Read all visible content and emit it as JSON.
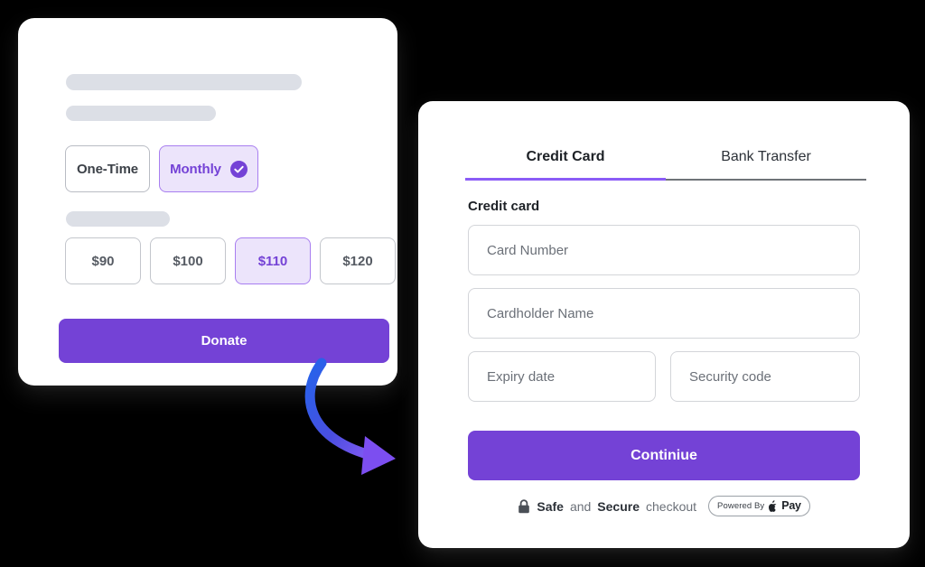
{
  "theme": {
    "background": "#000000",
    "card_bg": "#ffffff",
    "accent_purple": "#7442d6",
    "accent_purple_light": "#ece4fb",
    "accent_border": "#a87ef0",
    "tab_underline": "#8b5cf6",
    "skeleton_gray": "#dcdfe6",
    "text_dark": "#1d2126",
    "text_muted": "#6b7078",
    "arrow_gradient_from": "#2563eb",
    "arrow_gradient_to": "#8b5cf6"
  },
  "donation_card": {
    "placeholder_bars": [
      "title-bar",
      "subtitle-bar",
      "amount-label-bar"
    ],
    "frequency_options": [
      {
        "label": "One-Time",
        "selected": false
      },
      {
        "label": "Monthly",
        "selected": true
      }
    ],
    "frequency_selected_icon": "check-circle-icon",
    "amounts": [
      {
        "label": "$90",
        "selected": false
      },
      {
        "label": "$100",
        "selected": false
      },
      {
        "label": "$110",
        "selected": true
      },
      {
        "label": "$120",
        "selected": false
      }
    ],
    "submit_label": "Donate"
  },
  "checkout_card": {
    "tabs": [
      {
        "label": "Credit Card",
        "active": true
      },
      {
        "label": "Bank Transfer",
        "active": false
      }
    ],
    "section_label": "Credit card",
    "fields": [
      {
        "name": "card-number",
        "placeholder": "Card Number",
        "value": ""
      },
      {
        "name": "cardholder-name",
        "placeholder": "Cardholder Name",
        "value": ""
      },
      {
        "name": "expiry-date",
        "placeholder": "Expiry date",
        "value": ""
      },
      {
        "name": "security-code",
        "placeholder": "Security code",
        "value": ""
      }
    ],
    "submit_label": "Continiue",
    "secure_note": {
      "lock_icon": "lock-icon",
      "safe_word": "Safe",
      "conjunction": " and ",
      "secure_word": "Secure",
      "suffix": " checkout"
    },
    "pay_badge": {
      "powered_by": "Powered By",
      "brand_icon": "apple-logo-icon",
      "brand_word": "Pay"
    }
  },
  "connector": {
    "icon": "curved-arrow-icon"
  }
}
